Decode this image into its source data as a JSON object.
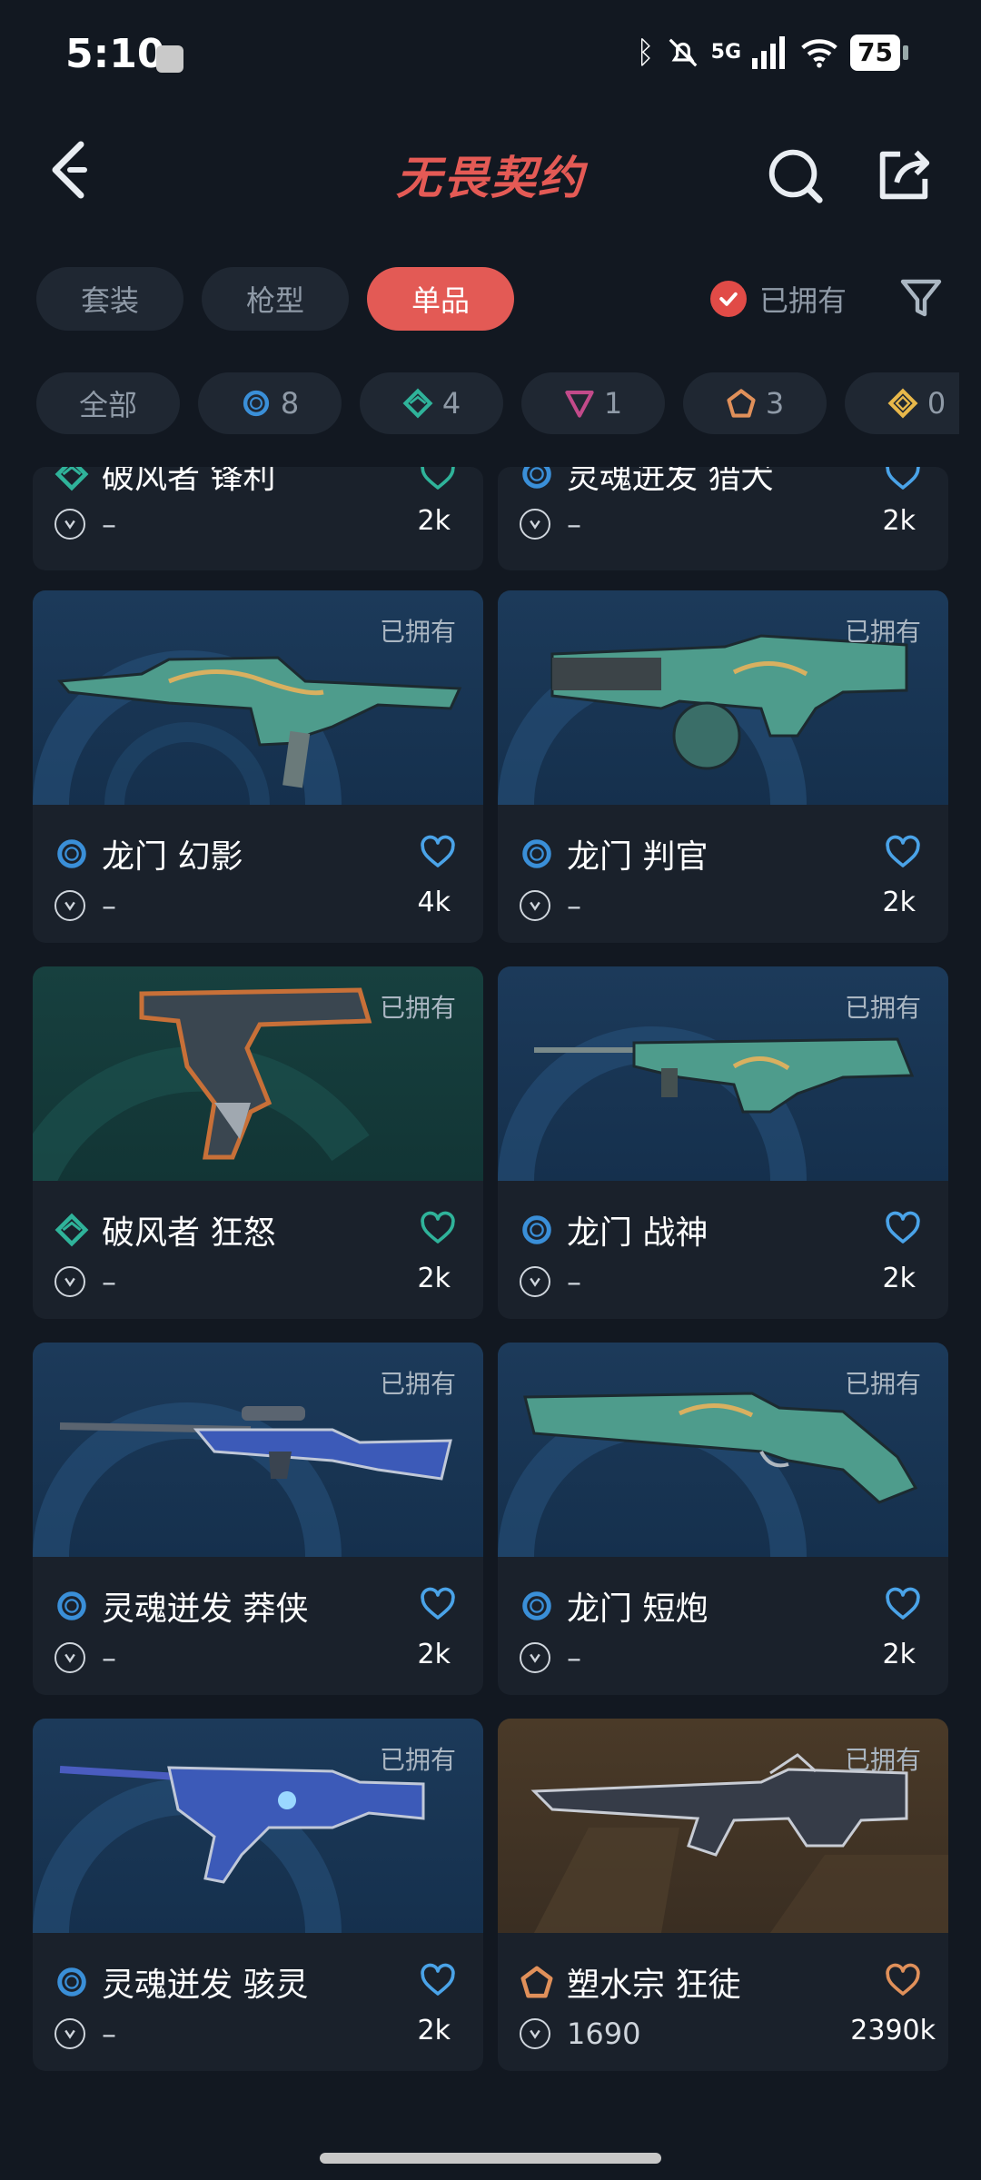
{
  "status_bar": {
    "time": "5:10",
    "network": "5G",
    "battery": "75"
  },
  "header": {
    "title": "无畏契约"
  },
  "tabs": [
    {
      "label": "套装",
      "active": false
    },
    {
      "label": "枪型",
      "active": false
    },
    {
      "label": "单品",
      "active": true
    }
  ],
  "owned_filter": {
    "label": "已拥有",
    "checked": true
  },
  "rarity_chips": [
    {
      "label": "全部",
      "count": ""
    },
    {
      "icon": "select-tier-icon",
      "color": "#3a8fd8",
      "count": "8"
    },
    {
      "icon": "deluxe-tier-icon",
      "color": "#2fb39a",
      "count": "4"
    },
    {
      "icon": "premium-tier-icon",
      "color": "#c24a8a",
      "count": "1"
    },
    {
      "icon": "exclusive-tier-icon",
      "color": "#e0905a",
      "count": "3"
    },
    {
      "icon": "ultra-tier-icon",
      "color": "#e8b84a",
      "count": "0"
    }
  ],
  "partial_items": [
    {
      "name": "破风者 锋利",
      "tier": "deluxe",
      "price": "–",
      "favorites": "2k"
    },
    {
      "name": "灵魂迸发 猎犬",
      "tier": "select",
      "price": "–",
      "favorites": "2k"
    }
  ],
  "items": [
    {
      "name": "龙门 幻影",
      "tier": "select",
      "owned_label": "已拥有",
      "price": "–",
      "favorites": "4k",
      "bg": "blue"
    },
    {
      "name": "龙门 判官",
      "tier": "select",
      "owned_label": "已拥有",
      "price": "–",
      "favorites": "2k",
      "bg": "blue"
    },
    {
      "name": "破风者 狂怒",
      "tier": "deluxe",
      "owned_label": "已拥有",
      "price": "–",
      "favorites": "2k",
      "bg": "teal"
    },
    {
      "name": "龙门 战神",
      "tier": "select",
      "owned_label": "已拥有",
      "price": "–",
      "favorites": "2k",
      "bg": "blue"
    },
    {
      "name": "灵魂迸发 莽侠",
      "tier": "select",
      "owned_label": "已拥有",
      "price": "–",
      "favorites": "2k",
      "bg": "blue"
    },
    {
      "name": "龙门 短炮",
      "tier": "select",
      "owned_label": "已拥有",
      "price": "–",
      "favorites": "2k",
      "bg": "blue"
    },
    {
      "name": "灵魂迸发 骇灵",
      "tier": "select",
      "owned_label": "已拥有",
      "price": "–",
      "favorites": "2k",
      "bg": "blue"
    },
    {
      "name": "塑水宗 狂徒",
      "tier": "exclusive",
      "owned_label": "已拥有",
      "price": "1690",
      "favorites": "2390k",
      "bg": "bronze"
    }
  ],
  "colors": {
    "accent": "#e35a55",
    "tier_select": "#3a8fd8",
    "tier_deluxe": "#2fb39a",
    "tier_premium": "#c24a8a",
    "tier_exclusive": "#e0905a",
    "tier_ultra": "#e8b84a",
    "fav_blue": "#4aa3e8",
    "fav_teal": "#2fb39a",
    "fav_orange": "#e0905a"
  }
}
